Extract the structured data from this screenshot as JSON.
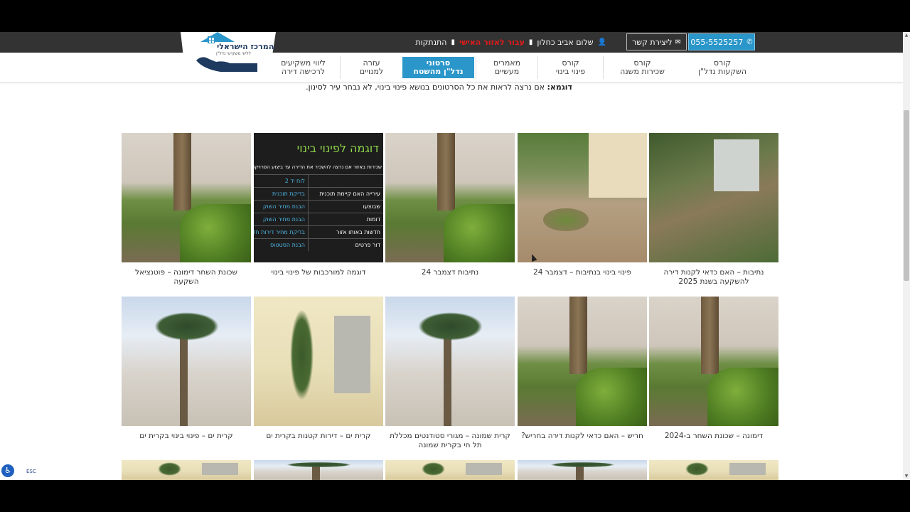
{
  "topbar": {
    "phone": "055-5525257",
    "contact": "ליצירת קשר",
    "greeting": "שלום אביב כחלון",
    "red_link": "עבור לאזור האישי",
    "logout": "התנתקות"
  },
  "logo": {
    "title": "המרכז הישראלי",
    "subtitle": "לליווי משקיעי נדל\"ן"
  },
  "nav": {
    "items": [
      {
        "line1": "קורס",
        "line2": "השקעות נדל\"ן"
      },
      {
        "line1": "קורס",
        "line2": "שכירות משנה"
      },
      {
        "line1": "קורס",
        "line2": "פינוי בינוי"
      },
      {
        "line1": "מאמרים",
        "line2": "מעשיים"
      },
      {
        "line1": "סרטוני",
        "line2": "נדל\"ן מהשטח"
      },
      {
        "line1": "עזרה",
        "line2": "למנויים"
      },
      {
        "line1": "ליווי משקיעים",
        "line2": "לרכישה דירה"
      }
    ]
  },
  "intro": {
    "bold": "דוגמא:",
    "text": " אם נרצה לראות את כל הסרטונים בנושא פינוי בינוי, לא נבחר עיר לסינון."
  },
  "slide": {
    "title": "דוגמה לפינוי בינוי",
    "subtitle": "שכירות באזור אם נרצה להשכיר את הדירה עד ביצוע הפרויקט",
    "rows": [
      {
        "left": "",
        "right": "לוח יד 2"
      },
      {
        "left": "עירייה האם קיימת תוכנית",
        "right": "בדיקת תוכנית"
      },
      {
        "left": "שבוצעו",
        "right": "הבנת מחיר השוק"
      },
      {
        "left": "דומות",
        "right": "הבנת מחיר השוק"
      },
      {
        "left": "חדשות באותו אזור",
        "right": "בדיקת מחיר דירות חדשות"
      },
      {
        "left": "דור פרטים",
        "right": "הבנת הסטטוס"
      }
    ]
  },
  "gallery": {
    "row1": [
      "נתיבות – האם כדאי לקנות דירה להשקעה בשנת 2025",
      "פינוי בינוי בנתיבות – דצמבר 24",
      "נתיבות דצמבר 24",
      "דוגמה למורכבות של פינוי בינוי",
      "שכונת השחר דימונה – פוטנציאל השקעה"
    ],
    "row2": [
      "דימונה – שכונת השחר ב-2024",
      "חריש – האם כדאי לקנות דירה בחריש?",
      "קרית שמונה – מגורי סטודנטים מכללת תל חי בקרית שמונה",
      "קרית ים – דירות קטנות בקרית ים",
      "קרית ים – פינוי בינוי בקרית ים"
    ]
  },
  "accessibility": {
    "esc": "ESC"
  }
}
